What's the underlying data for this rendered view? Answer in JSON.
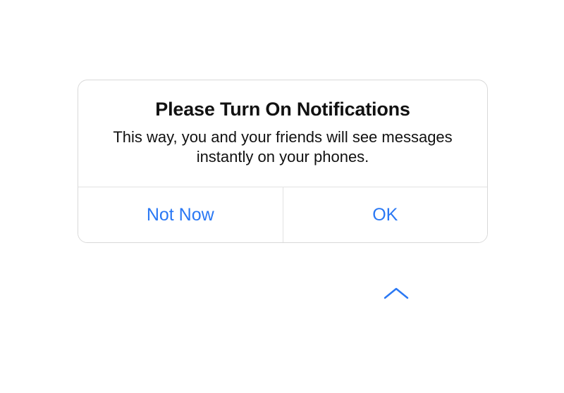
{
  "dialog": {
    "title": "Please Turn On Notifications",
    "message": "This way, you and your friends will see messages instantly on your phones.",
    "actions": {
      "not_now": "Not Now",
      "ok": "OK"
    }
  }
}
